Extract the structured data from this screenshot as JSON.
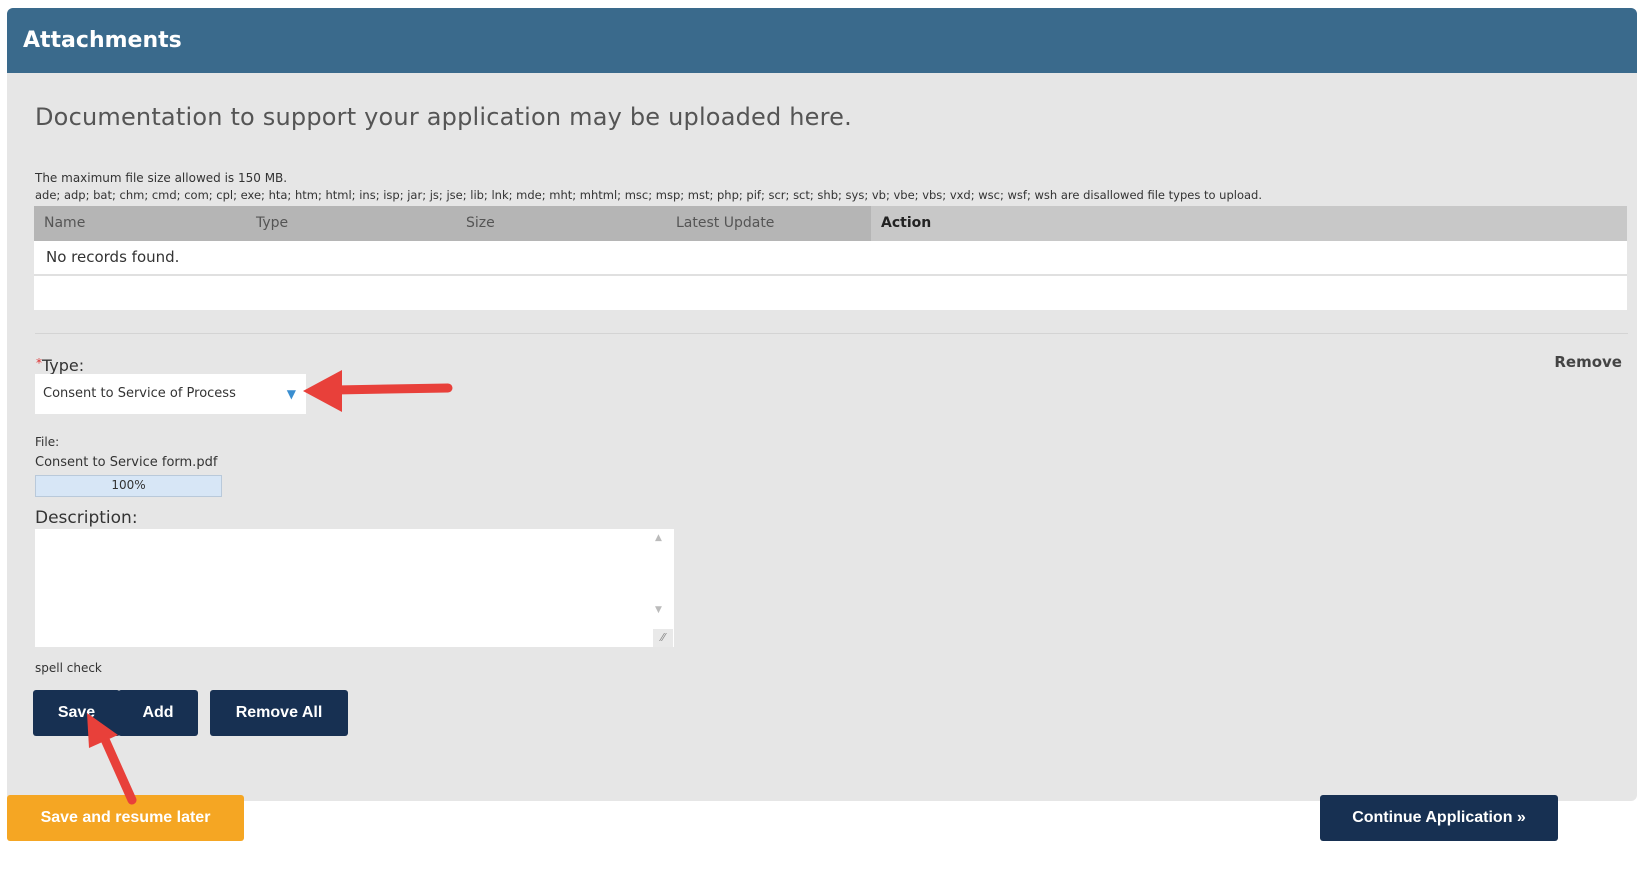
{
  "panel": {
    "title": "Attachments",
    "intro": "Documentation to support your application may be uploaded here.",
    "max_size_note": "The maximum file size allowed is 150 MB.",
    "disallowed_note": "ade; adp; bat; chm; cmd; com; cpl; exe; hta; htm; html; ins; isp; jar; js; jse; lib; lnk; mde; mht; mhtml; msc; msp; mst; php; pif; scr; sct; shb; sys; vb; vbe; vbs; vxd; wsc; wsf; wsh are disallowed file types to upload."
  },
  "grid": {
    "columns": [
      "Name",
      "Type",
      "Size",
      "Latest Update",
      "Action"
    ],
    "empty_text": "No records found."
  },
  "form": {
    "required_mark": "*",
    "type_label": "Type:",
    "remove_label": "Remove",
    "type_value": "Consent to Service of Process",
    "file_label": "File:",
    "file_name": "Consent to Service form.pdf",
    "upload_progress": "100%",
    "upload_fraction": 1.0,
    "description_label": "Description:",
    "description_value": "",
    "spell_check": "spell check"
  },
  "buttons": {
    "save": "Save",
    "add": "Add",
    "remove_all": "Remove All",
    "save_later": "Save and resume later",
    "continue": "Continue Application »"
  },
  "icons": {
    "dropdown": "triangle-down-icon",
    "annotation": "red-arrow-icon"
  },
  "colors": {
    "header": "#3a6a8c",
    "primary_button": "#173052",
    "save_later_button": "#f5a623",
    "annotation_arrow": "#e8403a"
  }
}
